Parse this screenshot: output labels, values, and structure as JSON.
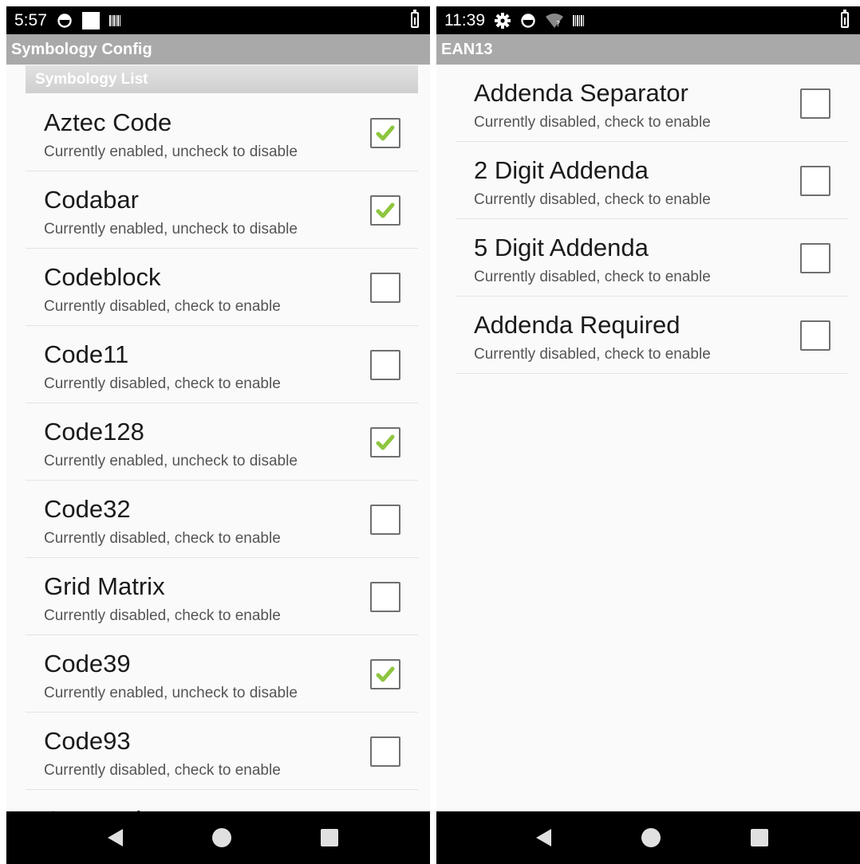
{
  "colors": {
    "status_bar": "#000000",
    "action_bar": "#a9a9a9",
    "check_mark": "#8dc63f",
    "checkbox_border": "#6f6f6f"
  },
  "left_screen": {
    "status_bar": {
      "time": "5:57",
      "icons": [
        "sync-icon",
        "white-square-icon",
        "barcode-icon",
        "battery-charging-icon"
      ]
    },
    "action_bar": {
      "title": "Symbology Config"
    },
    "category": {
      "title": "Symbology List"
    },
    "items": [
      {
        "title": "Aztec Code",
        "summary": "Currently enabled, uncheck to disable",
        "checked": true
      },
      {
        "title": "Codabar",
        "summary": "Currently enabled, uncheck to disable",
        "checked": true
      },
      {
        "title": "Codeblock",
        "summary": "Currently disabled, check to enable",
        "checked": false
      },
      {
        "title": "Code11",
        "summary": "Currently disabled, check to enable",
        "checked": false
      },
      {
        "title": "Code128",
        "summary": "Currently enabled, uncheck to disable",
        "checked": true
      },
      {
        "title": "Code32",
        "summary": "Currently disabled, check to enable",
        "checked": false
      },
      {
        "title": "Grid Matrix",
        "summary": "Currently disabled, check to enable",
        "checked": false
      },
      {
        "title": "Code39",
        "summary": "Currently enabled, uncheck to disable",
        "checked": true
      },
      {
        "title": "Code93",
        "summary": "Currently disabled, check to enable",
        "checked": false
      }
    ],
    "partial_item_title": "Composite"
  },
  "right_screen": {
    "status_bar": {
      "time": "11:39",
      "icons": [
        "gear-icon",
        "sync-icon",
        "wifi-unknown-icon",
        "barcode-icon",
        "battery-charging-icon"
      ]
    },
    "action_bar": {
      "title": "EAN13"
    },
    "items": [
      {
        "title": "Addenda Separator",
        "summary": "Currently disabled, check to enable",
        "checked": false
      },
      {
        "title": "2 Digit Addenda",
        "summary": "Currently disabled, check to enable",
        "checked": false
      },
      {
        "title": "5 Digit Addenda",
        "summary": "Currently disabled, check to enable",
        "checked": false
      },
      {
        "title": "Addenda Required",
        "summary": "Currently disabled, check to enable",
        "checked": false
      }
    ]
  },
  "nav_bar": {
    "buttons": [
      "back-icon",
      "home-icon",
      "recents-icon"
    ]
  }
}
